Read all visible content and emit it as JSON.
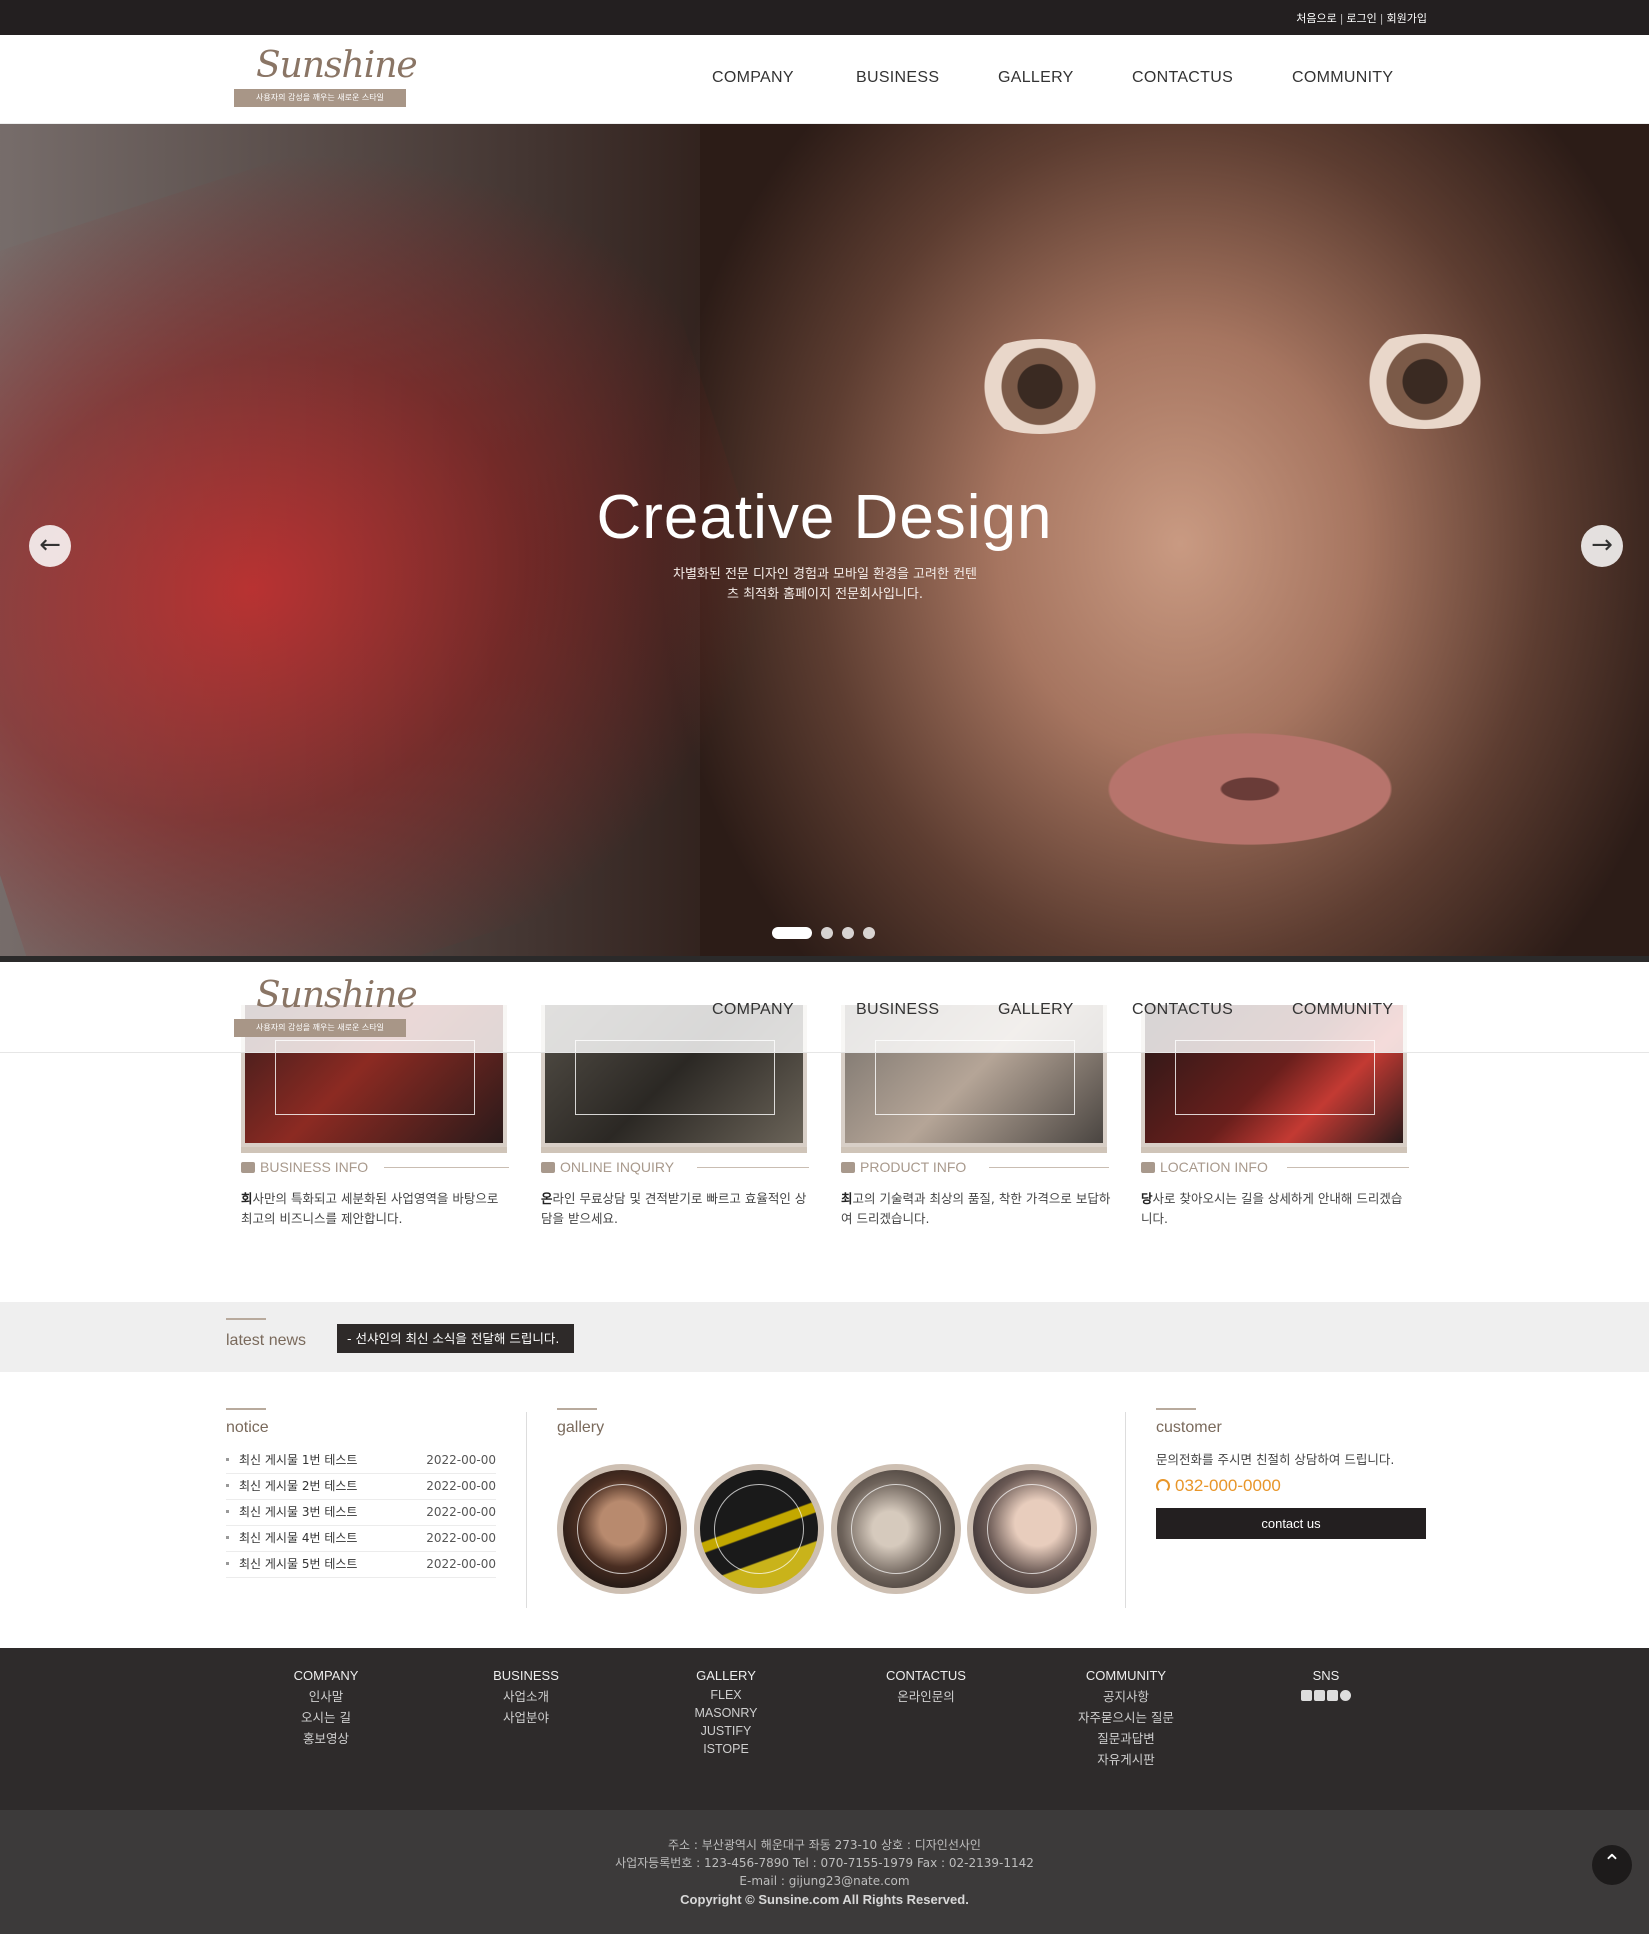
{
  "topbar": {
    "links": [
      "처음으로",
      "로그인",
      "회원가입"
    ]
  },
  "logo": {
    "script": "Sunshine",
    "tagline": "사용자의 감성을 깨우는 새로운 스타일"
  },
  "nav": [
    "COMPANY",
    "BUSINESS",
    "GALLERY",
    "CONTACTUS",
    "COMMUNITY"
  ],
  "hero": {
    "title": "Creative Design",
    "subtitle_line1": "차별화된 전문 디자인 경험과 모바일 환경을 고려한 컨텐",
    "subtitle_line2": "츠 최적화 홈페이지 전문회사입니다.",
    "prev_icon": "arrow-left-icon",
    "next_icon": "arrow-right-icon",
    "slides": 4,
    "active_slide": 1
  },
  "cards": [
    {
      "title": "BUSINESS INFO",
      "icon": "briefcase-icon",
      "first": "회",
      "text": "사만의 특화되고 세분화된 사업영역을 바탕으로 최고의 비즈니스를 제안합니다."
    },
    {
      "title": "ONLINE INQUIRY",
      "icon": "chat-icon",
      "first": "온",
      "text": "라인 무료상담 및 견적받기로 빠르고 효율적인 상담을 받으세요."
    },
    {
      "title": "PRODUCT INFO",
      "icon": "box-icon",
      "first": "최",
      "text": "고의 기술력과 최상의 품질, 착한 가격으로 보답하여 드리겠습니다."
    },
    {
      "title": "LOCATION INFO",
      "icon": "map-icon",
      "first": "당",
      "text": "사로 찾아오시는 길을 상세하게 안내해 드리겠습니다."
    }
  ],
  "news": {
    "label": "latest news",
    "text": "- 선샤인의 최신 소식을 전달해 드립니다."
  },
  "notice": {
    "title": "notice",
    "items": [
      {
        "title": "최신 게시물 1번 테스트",
        "date": "2022-00-00"
      },
      {
        "title": "최신 게시물 2번 테스트",
        "date": "2022-00-00"
      },
      {
        "title": "최신 게시물 3번 테스트",
        "date": "2022-00-00"
      },
      {
        "title": "최신 게시물 4번 테스트",
        "date": "2022-00-00"
      },
      {
        "title": "최신 게시물 5번 테스트",
        "date": "2022-00-00"
      }
    ]
  },
  "gallery": {
    "title": "gallery",
    "count": 4
  },
  "customer": {
    "title": "customer",
    "text": "문의전화를 주시면 친절히 상담하여 드립니다.",
    "phone": "032-000-0000",
    "button": "contact us"
  },
  "footer": {
    "columns": [
      {
        "title": "COMPANY",
        "items": [
          "인사말",
          "오시는 길",
          "홍보영상"
        ]
      },
      {
        "title": "BUSINESS",
        "items": [
          "사업소개",
          "사업분야"
        ]
      },
      {
        "title": "GALLERY",
        "items": [
          "FLEX",
          "MASONRY",
          "JUSTIFY",
          "ISTOPE"
        ]
      },
      {
        "title": "CONTACTUS",
        "items": [
          "온라인문의"
        ]
      },
      {
        "title": "COMMUNITY",
        "items": [
          "공지사항",
          "자주묻으시는 질문",
          "질문과답변",
          "자유게시판"
        ]
      },
      {
        "title": "SNS",
        "items": []
      }
    ],
    "address": "주소 : 부산광역시 해운대구 좌동 273-10 상호 : 디자인선사인",
    "bizinfo": "사업자등록번호 : 123-456-7890 Tel : 070-7155-1979 Fax : 02-2139-1142",
    "email": "E-mail : gijung23@nate.com",
    "copyright": "Copyright © Sunsine.com All Rights Reserved."
  }
}
